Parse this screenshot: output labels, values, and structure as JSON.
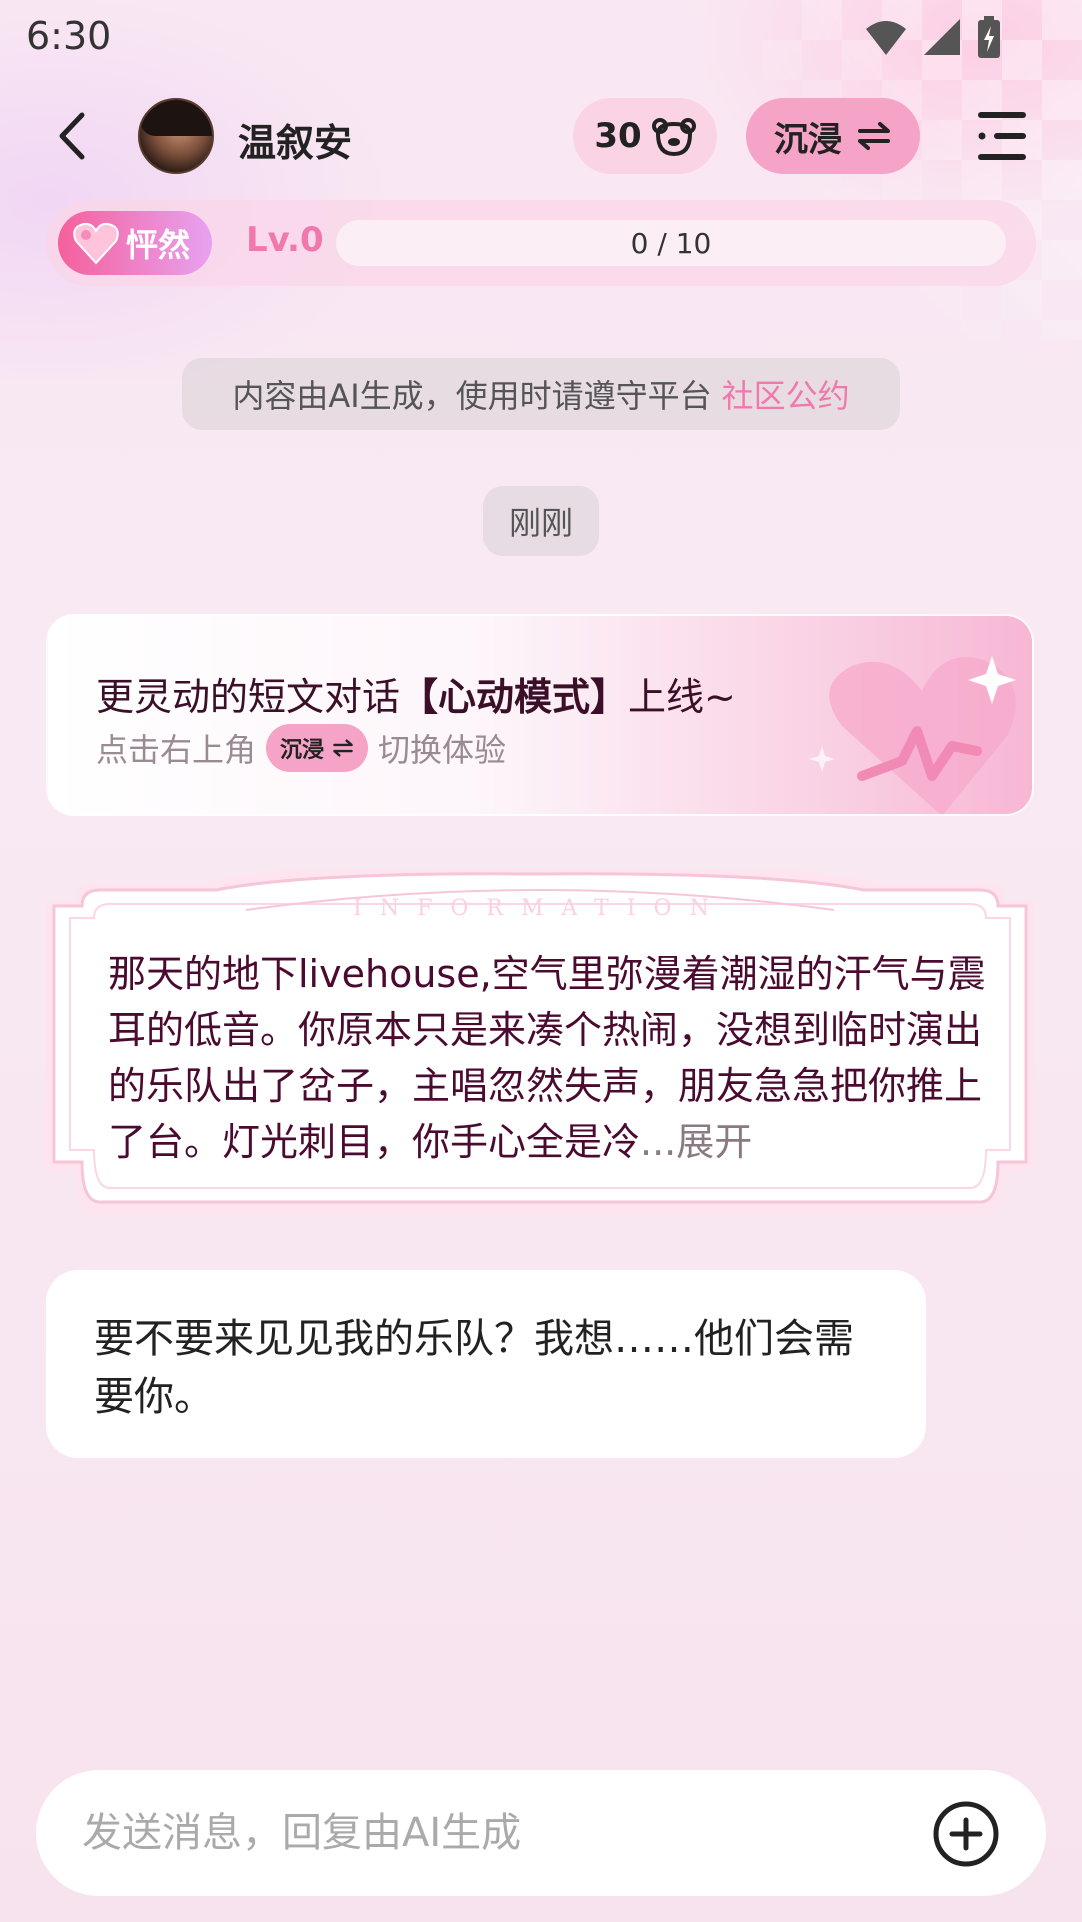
{
  "status": {
    "time": "6:30"
  },
  "header": {
    "name": "温叙安",
    "coins": "30",
    "mode_label": "沉浸"
  },
  "level": {
    "badge": "怦然",
    "level_text": "Lv.0",
    "progress_text": "0 / 10",
    "progress_value": 0
  },
  "notice": {
    "text": "内容由AI生成，使用时请遵守平台",
    "link": "社区公约"
  },
  "timestamp": "刚刚",
  "promo": {
    "title_pre": "更灵动的短文对话",
    "title_bold": "【心动模式】",
    "title_post": "上线~",
    "sub_pre": "点击右上角",
    "pill_label": "沉浸",
    "sub_post": "切换体验"
  },
  "info": {
    "header_word": "INFORMATION",
    "text": "那天的地下livehouse,空气里弥漫着潮湿的汗气与震耳的低音。你原本只是来凑个热闹，没想到临时演出的乐队出了岔子，主唱忽然失声，朋友急急把你推上了台。灯光刺目，你手心全是冷",
    "more": "...展开"
  },
  "message": {
    "text": "要不要来见见我的乐队？我想……他们会需要你。"
  },
  "input": {
    "placeholder": "发送消息，回复由AI生成"
  },
  "colors": {
    "accent_pink": "#f178ac",
    "pill_pink": "#f5a3c6",
    "info_text": "#4b0a30"
  }
}
